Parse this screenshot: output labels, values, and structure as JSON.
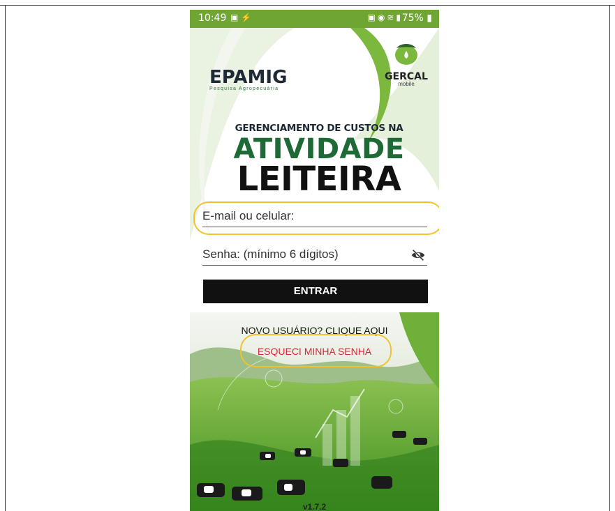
{
  "status_bar": {
    "time": "10:49",
    "battery": "75%",
    "left_icons": [
      "photo-notification-icon",
      "usb-icon"
    ],
    "right_icons": [
      "lock-icon",
      "alarm-icon",
      "wifi-icon",
      "volte-icon",
      "signal-icon"
    ]
  },
  "branding": {
    "epamig_name": "EPAMIG",
    "epamig_tagline": "Pesquisa Agropecuária",
    "gercal_name": "GERCAL",
    "gercal_sub": "mobile"
  },
  "headline": {
    "line1": "GERENCIAMENTO DE CUSTOS NA",
    "line2": "ATIVIDADE",
    "line3": "LEITEIRA"
  },
  "form": {
    "email_placeholder": "E-mail ou celular:",
    "password_placeholder": "Senha: (mínimo 6 dígitos)",
    "submit_label": "ENTRAR"
  },
  "links": {
    "new_user": "NOVO USUÁRIO? CLIQUE AQUI",
    "forgot_password": "ESQUECI MINHA SENHA"
  },
  "version": "v1.7.2",
  "colors": {
    "status_bar": "#6fa533",
    "brand_green": "#1e6a37",
    "button": "#111111",
    "forgot_link": "#d5283a",
    "highlight": "#f0c230"
  }
}
